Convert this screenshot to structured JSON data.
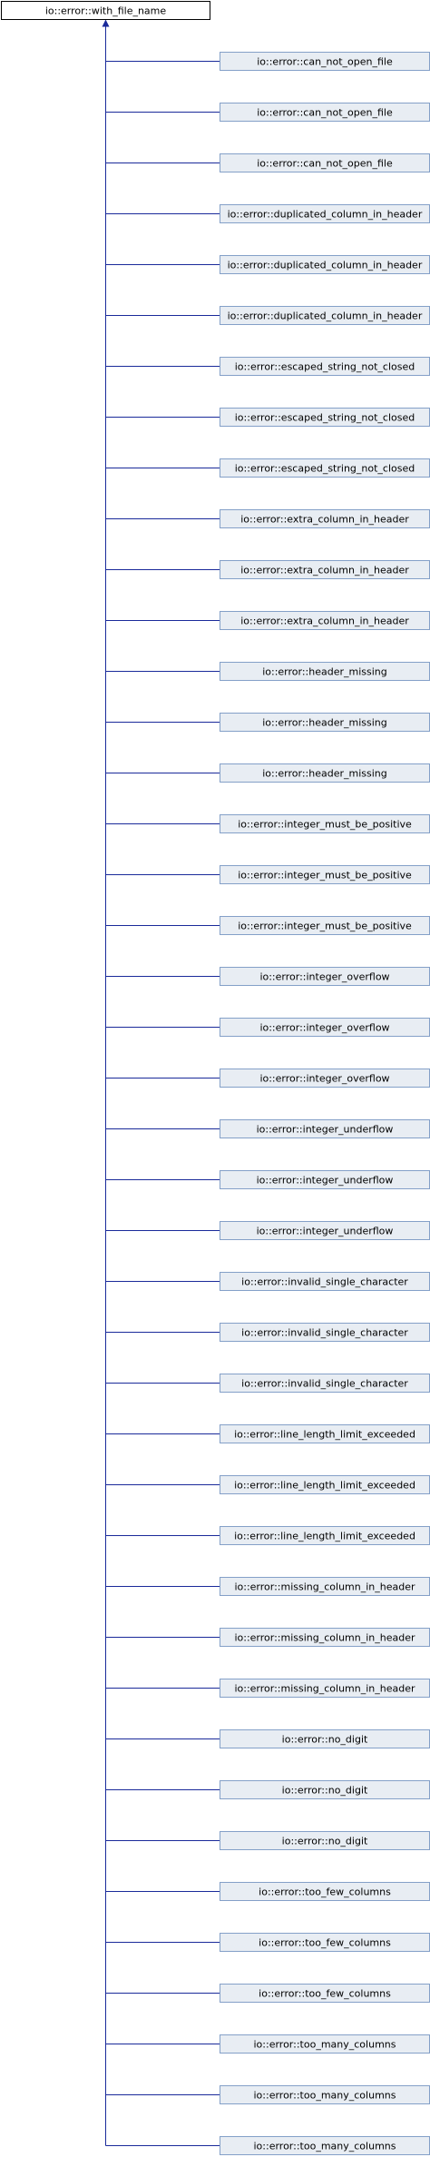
{
  "root": "io::error::with_file_name",
  "children": [
    "io::error::can_not_open_file",
    "io::error::can_not_open_file",
    "io::error::can_not_open_file",
    "io::error::duplicated_column_in_header",
    "io::error::duplicated_column_in_header",
    "io::error::duplicated_column_in_header",
    "io::error::escaped_string_not_closed",
    "io::error::escaped_string_not_closed",
    "io::error::escaped_string_not_closed",
    "io::error::extra_column_in_header",
    "io::error::extra_column_in_header",
    "io::error::extra_column_in_header",
    "io::error::header_missing",
    "io::error::header_missing",
    "io::error::header_missing",
    "io::error::integer_must_be_positive",
    "io::error::integer_must_be_positive",
    "io::error::integer_must_be_positive",
    "io::error::integer_overflow",
    "io::error::integer_overflow",
    "io::error::integer_overflow",
    "io::error::integer_underflow",
    "io::error::integer_underflow",
    "io::error::integer_underflow",
    "io::error::invalid_single_character",
    "io::error::invalid_single_character",
    "io::error::invalid_single_character",
    "io::error::line_length_limit_exceeded",
    "io::error::line_length_limit_exceeded",
    "io::error::line_length_limit_exceeded",
    "io::error::missing_column_in_header",
    "io::error::missing_column_in_header",
    "io::error::missing_column_in_header",
    "io::error::no_digit",
    "io::error::no_digit",
    "io::error::no_digit",
    "io::error::too_few_columns",
    "io::error::too_few_columns",
    "io::error::too_few_columns",
    "io::error::too_many_columns",
    "io::error::too_many_columns",
    "io::error::too_many_columns"
  ],
  "colors": {
    "edge": "#1a2a9a",
    "child_fill": "#e8edf3",
    "child_border": "#84a0c8",
    "root_border": "#000000"
  }
}
